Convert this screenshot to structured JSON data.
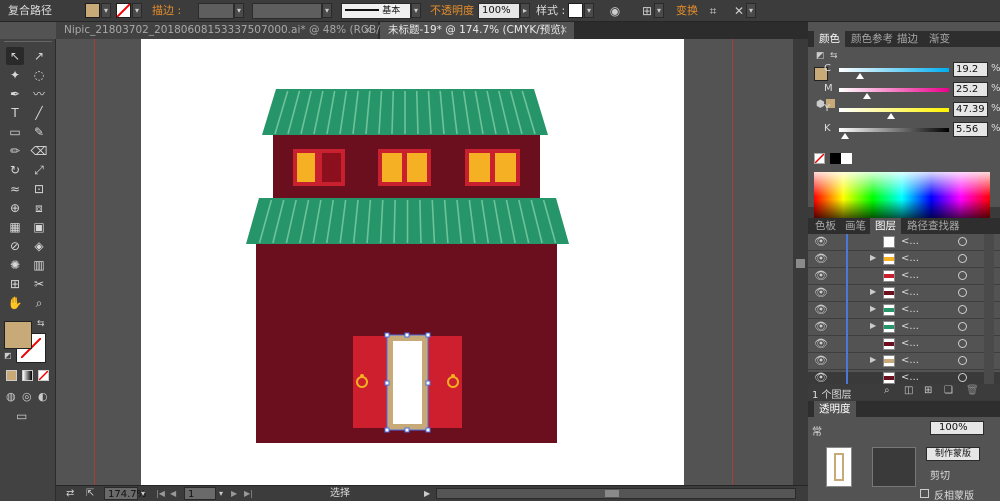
{
  "control_bar": {
    "object_type": "复合路径",
    "fill_color": "#c8aa78",
    "stroke_label": "描边 :",
    "stroke_style_label": "基本",
    "opacity_label": "不透明度 :",
    "opacity_value": "100%",
    "style_label": "样式 :",
    "transform_label": "变换"
  },
  "tabs": [
    {
      "label": "Nipic_21803702_20180608153337507000.ai* @ 48% (RGB/预览)",
      "active": false
    },
    {
      "label": "未标题-19* @ 174.7% (CMYK/预览)",
      "active": true
    }
  ],
  "tools": {
    "fill_color": "#c8aa78",
    "icons": [
      "selection-arrow-icon",
      "direct-selection-icon",
      "magic-wand-icon",
      "lasso-icon",
      "pen-icon",
      "curvature-icon",
      "type-icon",
      "line-icon",
      "rectangle-icon",
      "paintbrush-icon",
      "pencil-icon",
      "eraser-icon",
      "rotate-icon",
      "scale-icon",
      "warp-icon",
      "free-transform-icon",
      "shape-builder-icon",
      "perspective-grid-icon",
      "mesh-icon",
      "gradient-icon",
      "eyedropper-icon",
      "blend-icon",
      "symbol-sprayer-icon",
      "column-graph-icon",
      "artboard-icon",
      "slice-icon",
      "hand-icon",
      "zoom-icon"
    ]
  },
  "status_bar": {
    "zoom": "174.7%",
    "artboard_number": "1",
    "tool_label": "选择"
  },
  "color_panel": {
    "tabs": [
      "颜色",
      "颜色参考",
      "描边",
      "渐变"
    ],
    "active_tab": 0,
    "channels": [
      {
        "name": "C",
        "value": "19.2",
        "pos": 0.192,
        "track": "linear-gradient(to right,#ffffff,#00aeef)"
      },
      {
        "name": "M",
        "value": "25.2",
        "pos": 0.252,
        "track": "linear-gradient(to right,#ffffff,#ec008c)"
      },
      {
        "name": "Y",
        "value": "47.39",
        "pos": 0.4739,
        "track": "linear-gradient(to right,#ffffff,#fff200)"
      },
      {
        "name": "K",
        "value": "5.56",
        "pos": 0.0556,
        "track": "linear-gradient(to right,#ffffff,#000000)"
      }
    ],
    "percent": "%"
  },
  "layers_panel": {
    "tabs": [
      "色板",
      "画笔",
      "图层",
      "路径查找器"
    ],
    "active_tab": 2,
    "rows": [
      {
        "name": "<...",
        "expand": false
      },
      {
        "name": "<...",
        "expand": true
      },
      {
        "name": "<...",
        "expand": false
      },
      {
        "name": "<...",
        "expand": true
      },
      {
        "name": "<...",
        "expand": true
      },
      {
        "name": "<...",
        "expand": true
      },
      {
        "name": "<...",
        "expand": false
      },
      {
        "name": "<...",
        "expand": true
      },
      {
        "name": "<...",
        "expand": false
      }
    ],
    "footer": "1 个图层"
  },
  "transparency_panel": {
    "title": "透明度",
    "opacity": "100%",
    "button": "制作蒙版",
    "clip": "剪切",
    "invert": "反相蒙版"
  },
  "house_colors": {
    "roof": "#27956a",
    "roof_stripe": "#6cc39a",
    "wall": "#6b0e1e",
    "window_frame": "#c8202f",
    "window_glass": "#f5b023",
    "door_panel": "#cd1f2d",
    "door_frame": "#c8aa78",
    "handle": "#f2b020"
  }
}
